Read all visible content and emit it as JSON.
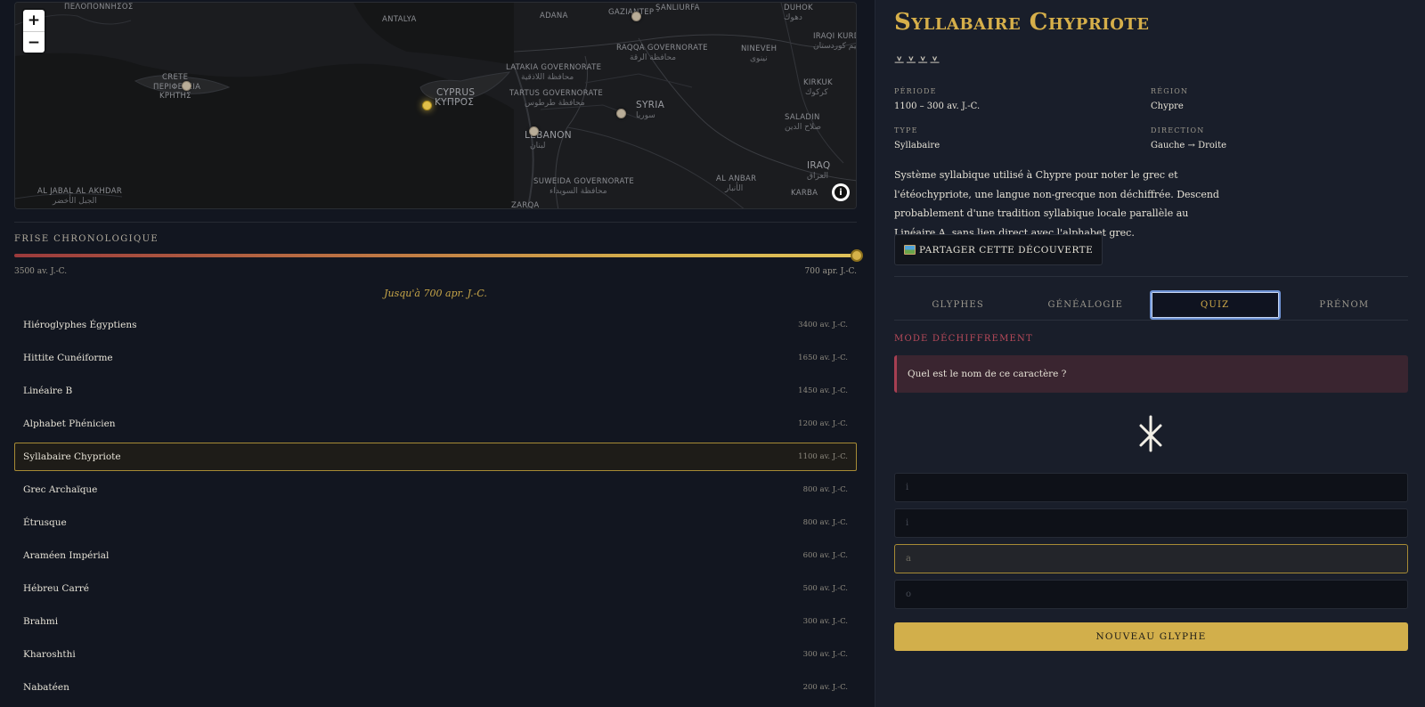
{
  "map": {
    "labels": {
      "pelop": "ΠΕΛΟΠΟΝΝΗΣΟΣ",
      "antalya": "ANTALYA",
      "adana": "ADANA",
      "gaziantep": "GAZIANTEP",
      "sanliurfa": "ŞANLIURFA",
      "duhok": "DUHOK",
      "duhok_ar": "دهوك",
      "raqqa": "RAQQA GOVERNORATE",
      "raqqa_ar": "محافظة الرقة",
      "nineveh": "NINEVEH",
      "nineveh_ar": "نينوى",
      "iraqi_kurd": "IRAQI KURDI",
      "iraqi_kurd_ar": "اقليم كوردستان",
      "crete": "CRETE",
      "crete_gr1": "ΠΕΡΙΦΕΡΕΙΑ",
      "crete_gr2": "ΚΡΗΤΗΣ",
      "cyprus": "CYPRUS",
      "cyprus_gr": "ΚΥΠΡΟΣ",
      "latakia": "LATAKIA GOVERNORATE",
      "latakia_ar": "محافظة اللاذقية",
      "tartus": "TARTUS GOVERNORATE",
      "tartus_ar": "محافظة طرطوس",
      "syria": "SYRIA",
      "syria_ar": "سوريا",
      "kirkuk": "KIRKUK",
      "kirkuk_ar": "كركوك",
      "saladin": "SALADIN",
      "saladin_ar": "صلاح الدين",
      "lebanon": "LEBANON",
      "lebanon_ar": "لبنان",
      "suweida": "SUWEIDA GOVERNORATE",
      "suweida_ar": "محافظة السويداء",
      "al_anbar": "AL ANBAR",
      "al_anbar_ar": "الأنبار",
      "iraq": "IRAQ",
      "iraq_ar": "العراق",
      "karbala": "KARBA",
      "al_jabal": "AL JABAL AL AKHDAR",
      "al_jabal_ar": "الجبل الأخضر",
      "zarqa": "ZARQA"
    },
    "zoom_in": "+",
    "zoom_out": "−",
    "info": "i"
  },
  "timeline": {
    "title": "FRISE CHRONOLOGIQUE",
    "start": "3500 av. J.-C.",
    "end": "700 apr. J.-C.",
    "until": "Jusqu'à 700 apr. J.-C.",
    "position": 1.0
  },
  "scripts": [
    {
      "name": "Hiéroglyphes Égyptiens",
      "date": "3400 av. J.-C."
    },
    {
      "name": "Hittite Cunéiforme",
      "date": "1650 av. J.-C."
    },
    {
      "name": "Linéaire B",
      "date": "1450 av. J.-C."
    },
    {
      "name": "Alphabet Phénicien",
      "date": "1200 av. J.-C."
    },
    {
      "name": "Syllabaire Chypriote",
      "date": "1100 av. J.-C."
    },
    {
      "name": "Grec Archaïque",
      "date": "800 av. J.-C."
    },
    {
      "name": "Étrusque",
      "date": "800 av. J.-C."
    },
    {
      "name": "Araméen Impérial",
      "date": "600 av. J.-C."
    },
    {
      "name": "Hébreu Carré",
      "date": "500 av. J.-C."
    },
    {
      "name": "Brahmi",
      "date": "300 av. J.-C."
    },
    {
      "name": "Kharoshthi",
      "date": "300 av. J.-C."
    },
    {
      "name": "Nabatéen",
      "date": "200 av. J.-C."
    }
  ],
  "selected_script_index": 4,
  "detail": {
    "title": "Syllabaire Chypriote",
    "glyphs": "⩡⩡⩡⩡",
    "period_label": "PÉRIODE",
    "period_value": "1100 – 300 av. J.-C.",
    "region_label": "RÉGION",
    "region_value": "Chypre",
    "type_label": "TYPE",
    "type_value": "Syllabaire",
    "direction_label": "DIRECTION",
    "direction_value": "Gauche → Droite",
    "description": "Système syllabique utilisé à Chypre pour noter le grec et l'étéochypriote, une langue non-grecque non déchiffrée. Descend probablement d'une tradition syllabique locale parallèle au Linéaire A, sans lien direct avec l'alphabet grec.",
    "share_label": "PARTAGER CETTE DÉCOUVERTE"
  },
  "tabs": [
    {
      "label": "GLYPHES"
    },
    {
      "label": "GÉNÉALOGIE"
    },
    {
      "label": "QUIZ"
    },
    {
      "label": "PRÉNOM"
    }
  ],
  "active_tab": 2,
  "quiz": {
    "mode_label": "MODE DÉCHIFFREMENT",
    "question": "Quel est le nom de ce caractère ?",
    "answers": [
      {
        "label": "i"
      },
      {
        "label": "i"
      },
      {
        "label": "a"
      },
      {
        "label": "o"
      }
    ],
    "highlighted_answer": 2,
    "new_glyph_label": "NOUVEAU GLYPHE"
  },
  "colors": {
    "accent_gold": "#d6af4a",
    "quiz_red": "#b94a5a",
    "panel_bg": "#191e2a",
    "page_bg": "#121620"
  }
}
